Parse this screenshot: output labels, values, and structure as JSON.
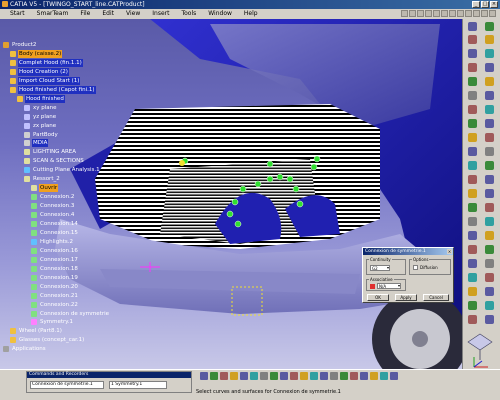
{
  "window": {
    "title": "CATIA V5 - [TWINGO_START_line.CATProduct]"
  },
  "menu": [
    "Start",
    "SmarTeam",
    "File",
    "Edit",
    "View",
    "Insert",
    "Tools",
    "Window",
    "Help"
  ],
  "tree": {
    "items": [
      {
        "label": "Product2",
        "depth": 0,
        "icon": "product-icon",
        "state": "normal"
      },
      {
        "label": "Body (caisse.2)",
        "depth": 1,
        "icon": "part-icon",
        "state": "highlight"
      },
      {
        "label": "Complet Hood (fin.1.1)",
        "depth": 1,
        "icon": "part-icon",
        "state": "selected"
      },
      {
        "label": "Hood Creation (2)",
        "depth": 1,
        "icon": "part-icon",
        "state": "selected"
      },
      {
        "label": "Import Cloud Start (1)",
        "depth": 1,
        "icon": "part-icon",
        "state": "selected"
      },
      {
        "label": "Hood finished (Capot fini.1)",
        "depth": 1,
        "icon": "part-icon",
        "state": "selected"
      },
      {
        "label": "Hood finished",
        "depth": 2,
        "icon": "part-icon",
        "state": "selected"
      },
      {
        "label": "xy plane",
        "depth": 3,
        "icon": "plane-icon",
        "state": "normal"
      },
      {
        "label": "yz plane",
        "depth": 3,
        "icon": "plane-icon",
        "state": "normal"
      },
      {
        "label": "zx plane",
        "depth": 3,
        "icon": "plane-icon",
        "state": "normal"
      },
      {
        "label": "PartBody",
        "depth": 3,
        "icon": "body-icon",
        "state": "normal"
      },
      {
        "label": "MDIA",
        "depth": 3,
        "icon": "body-icon",
        "state": "selected"
      },
      {
        "label": "LIGHTING AREA",
        "depth": 3,
        "icon": "set-icon",
        "state": "normal"
      },
      {
        "label": "SCAN & SECTIONS",
        "depth": 3,
        "icon": "set-icon",
        "state": "normal"
      },
      {
        "label": "Cutting Plane Analysis.1",
        "depth": 3,
        "icon": "analysis-icon",
        "state": "normal"
      },
      {
        "label": "Ressort_2",
        "depth": 3,
        "icon": "set-icon",
        "state": "normal"
      },
      {
        "label": "Ouvrir",
        "depth": 4,
        "icon": "set-icon",
        "state": "highlight"
      },
      {
        "label": "Connexion.2",
        "depth": 4,
        "icon": "connect-icon",
        "state": "normal"
      },
      {
        "label": "Connexion.3",
        "depth": 4,
        "icon": "connect-icon",
        "state": "normal"
      },
      {
        "label": "Connexion.4",
        "depth": 4,
        "icon": "connect-icon",
        "state": "normal"
      },
      {
        "label": "Connexion.14",
        "depth": 4,
        "icon": "connect-icon",
        "state": "normal"
      },
      {
        "label": "Connexion.15",
        "depth": 4,
        "icon": "connect-icon",
        "state": "normal"
      },
      {
        "label": "Highlights.2",
        "depth": 4,
        "icon": "analysis-icon",
        "state": "normal"
      },
      {
        "label": "Connexion.16",
        "depth": 4,
        "icon": "connect-icon",
        "state": "normal"
      },
      {
        "label": "Connexion.17",
        "depth": 4,
        "icon": "connect-icon",
        "state": "normal"
      },
      {
        "label": "Connexion.18",
        "depth": 4,
        "icon": "connect-icon",
        "state": "normal"
      },
      {
        "label": "Connexion.19",
        "depth": 4,
        "icon": "connect-icon",
        "state": "normal"
      },
      {
        "label": "Connexion.20",
        "depth": 4,
        "icon": "connect-icon",
        "state": "normal"
      },
      {
        "label": "Connexion.21",
        "depth": 4,
        "icon": "connect-icon",
        "state": "normal"
      },
      {
        "label": "Connexion.22",
        "depth": 4,
        "icon": "connect-icon",
        "state": "normal"
      },
      {
        "label": "Connexion de symmetrie",
        "depth": 4,
        "icon": "connect-icon",
        "state": "normal"
      },
      {
        "label": "Symmetry.1",
        "depth": 4,
        "icon": "symmetry-icon",
        "state": "normal"
      },
      {
        "label": "Wheel (Part8.1)",
        "depth": 1,
        "icon": "part-icon",
        "state": "normal"
      },
      {
        "label": "Glasses (concept_car.1)",
        "depth": 1,
        "icon": "part-icon",
        "state": "normal"
      },
      {
        "label": "Applications",
        "depth": 0,
        "icon": "app-icon",
        "state": "normal"
      }
    ]
  },
  "dialog": {
    "title": "Connexion de symmetrie.1",
    "continuity_label": "Continuity",
    "continuity_value": "G2",
    "options_label": "Options",
    "diffusion_label": "Diffusion",
    "associative_label": "Associative",
    "associative_value": "N/A",
    "ok": "OK",
    "apply": "Apply",
    "cancel": "Cancel"
  },
  "command_panel": {
    "title": "Commands and Recorders",
    "field1": "Connexion de symmetrie.1",
    "field2": "1 Symmetry.1"
  },
  "status": {
    "message": "Select curves and surfaces for Connexion de symmetrie.1"
  },
  "colors": {
    "car_body": "#2020b0",
    "bumper": "#9a9ad8",
    "hood_stripe": "#ffffff",
    "tree_text": "#ffffff",
    "highlight": "#f0a020",
    "selected": "#2030c0"
  }
}
